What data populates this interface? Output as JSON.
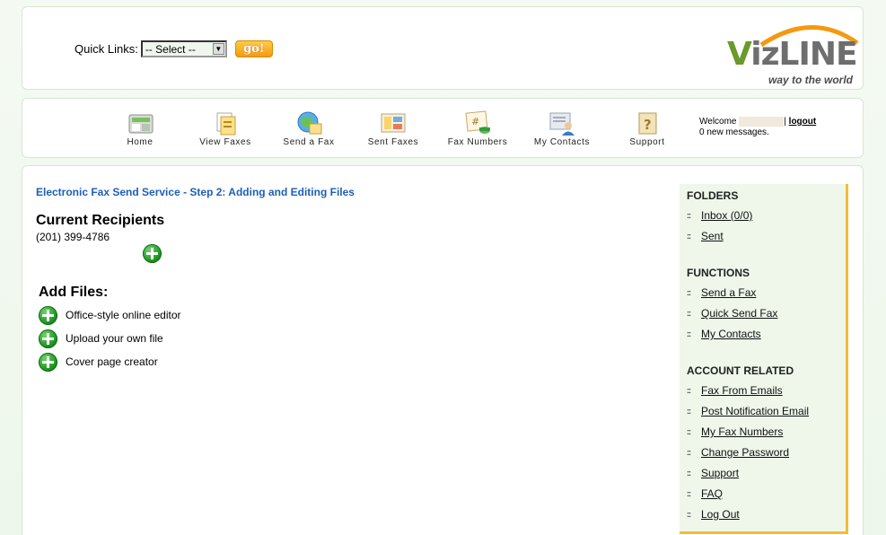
{
  "top": {
    "quick_links_label": "Quick Links:",
    "select_value": "-- Select --",
    "go_label": "go!"
  },
  "logo": {
    "brand_v": "V",
    "brand_rest": "izLINE",
    "tagline": "way to the world",
    "colors": {
      "green": "#6a9a2a",
      "gray": "#6e6e6e",
      "orange": "#f39a12"
    }
  },
  "nav": {
    "items": [
      {
        "label": "Home",
        "icon": "home-icon"
      },
      {
        "label": "View Faxes",
        "icon": "view-faxes-icon"
      },
      {
        "label": "Send a Fax",
        "icon": "send-fax-icon"
      },
      {
        "label": "Sent Faxes",
        "icon": "sent-faxes-icon"
      },
      {
        "label": "Fax Numbers",
        "icon": "fax-numbers-icon"
      },
      {
        "label": "My Contacts",
        "icon": "contacts-icon"
      },
      {
        "label": "Support",
        "icon": "support-icon"
      }
    ],
    "welcome_label": "Welcome",
    "separator": "|",
    "logout_label": "logout",
    "messages": "0 new messages."
  },
  "main": {
    "step_title": "Electronic Fax Send Service - Step 2: Adding and Editing Files",
    "recipients_heading": "Current Recipients",
    "recipient_phone": "(201) 399-4786",
    "add_files_heading": "Add Files:",
    "file_options": [
      "Office-style online editor",
      "Upload your own file",
      "Cover page creator"
    ]
  },
  "sidebar": {
    "folders_heading": "FOLDERS",
    "folders": [
      "Inbox (0/0)",
      "Sent"
    ],
    "functions_heading": "FUNCTIONS",
    "functions": [
      "Send a Fax",
      "Quick Send Fax",
      "My Contacts"
    ],
    "account_heading": "ACCOUNT RELATED",
    "account": [
      "Fax From Emails",
      "Post Notification Email",
      "My Fax Numbers",
      "Change Password",
      "Support",
      "FAQ",
      "Log Out"
    ],
    "bullet": "::"
  }
}
